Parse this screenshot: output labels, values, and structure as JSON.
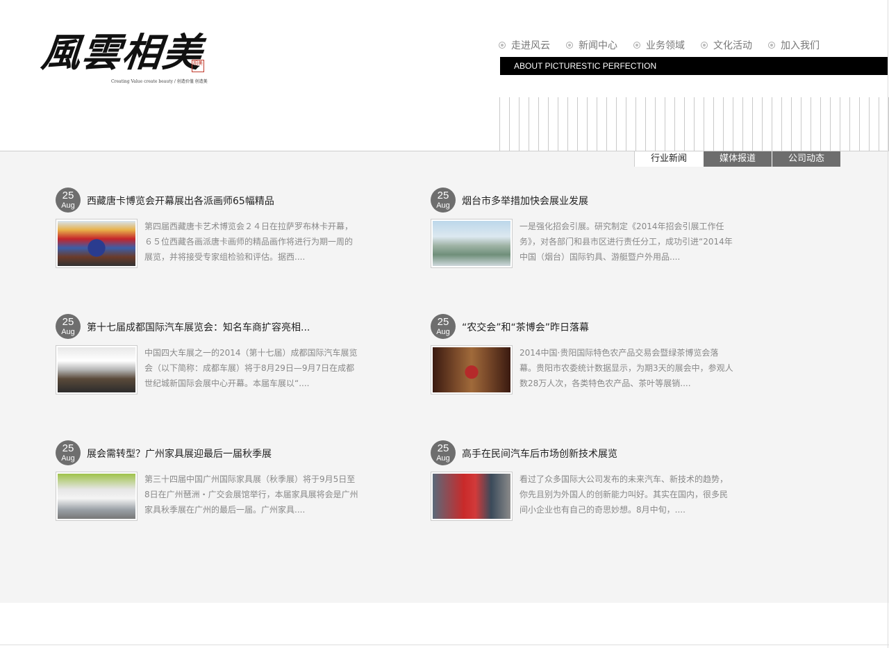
{
  "logo": {
    "text": "風雲相美",
    "seal": "相美",
    "tagline": "Creating Value create beauty / 创造价值 创造美"
  },
  "nav": {
    "items": [
      {
        "label": "走进风云"
      },
      {
        "label": "新闻中心"
      },
      {
        "label": "业务领域"
      },
      {
        "label": "文化活动"
      },
      {
        "label": "加入我们"
      }
    ]
  },
  "banner": {
    "text": "ABOUT PICTURESTIC PERFECTION"
  },
  "tabs": [
    {
      "label": "行业新闻",
      "active": true
    },
    {
      "label": "媒体报道",
      "active": false
    },
    {
      "label": "公司动态",
      "active": false
    }
  ],
  "articles": [
    {
      "day": "25",
      "month": "Aug",
      "title": "西藏唐卡博览会开幕展出各派画师65幅精品",
      "excerpt": "第四届西藏唐卡艺术博览会２４日在拉萨罗布林卡开幕，６５位西藏各画派唐卡画师的精品画作将进行为期一周的展览，并将接受专家组检验和评估。据西....",
      "image": "tibet"
    },
    {
      "day": "25",
      "month": "Aug",
      "title": "烟台市多举措加快会展业发展",
      "excerpt": "一是强化招会引展。研究制定《2014年招会引展工作任务》，对各部门和县市区进行责任分工，成功引进“2014年中国（烟台）国际钓具、游艇暨户外用品....",
      "image": "city"
    },
    {
      "day": "25",
      "month": "Aug",
      "title": "第十七届成都国际汽车展览会：知名车商扩容亮相...",
      "excerpt": "中国四大车展之一的2014（第十七届）成都国际汽车展览会（以下简称：成都车展）将于8月29日—9月7日在成都世纪城新国际会展中心开幕。本届车展以“....",
      "image": "auto"
    },
    {
      "day": "25",
      "month": "Aug",
      "title": "“农交会”和“茶博会”昨日落幕",
      "excerpt": "2014中国·贵阳国际特色农产品交易会暨绿茶博览会落幕。贵阳市农委统计数据显示，为期3天的展会中，参观人数28万人次，各类特色农产品、茶叶等展销....",
      "image": "tea"
    },
    {
      "day": "25",
      "month": "Aug",
      "title": "展会需转型？广州家具展迎最后一届秋季展",
      "excerpt": "第三十四届中国广州国际家具展（秋季展）将于9月5日至8日在广州琶洲・广交会展馆举行，本届家具展将会是广州家具秋季展在广州的最后一届。广州家具....",
      "image": "furniture"
    },
    {
      "day": "25",
      "month": "Aug",
      "title": "高手在民间汽车后市场创新技术展览",
      "excerpt": "看过了众多国际大公司发布的未来汽车、新技术的趋势，你先且别为外国人的创新能力叫好。其实在国内，很多民间小企业也有自己的奇思妙想。8月中旬，....",
      "image": "expo"
    }
  ]
}
